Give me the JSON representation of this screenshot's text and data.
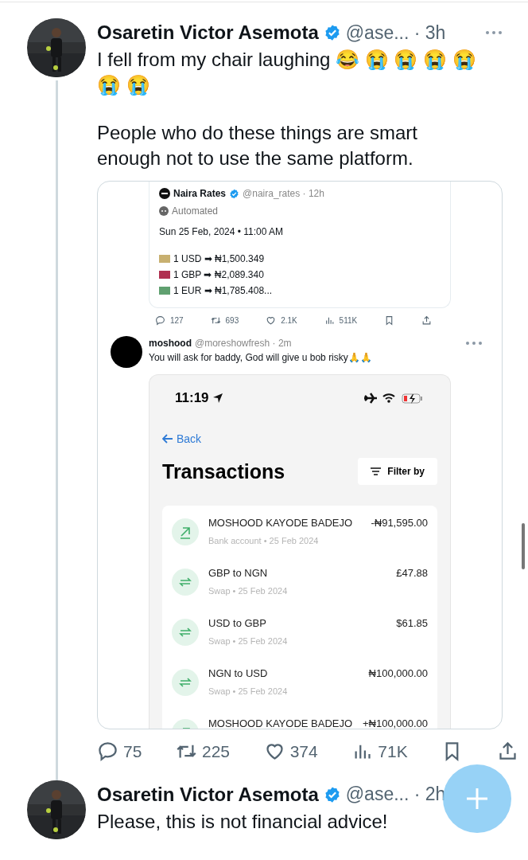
{
  "tweets": [
    {
      "author": "Osaretin Victor Asemota",
      "verified": true,
      "meta": "@ase... · 3h",
      "paragraphs": [
        "I fell from my chair laughing 😂 😭 😭 😭 😭 😭 😭",
        "People who do these things are smart enough not to use the same platform."
      ],
      "media": {
        "quoted": {
          "author": "Naira Rates",
          "verified": true,
          "meta": "@naira_rates · 12h",
          "label": "Automated",
          "date": "Sun 25 Feb, 2024 • 11:00 AM",
          "rates": [
            {
              "text": "1 USD ➡ ₦1,500.349",
              "color": "#c8b070"
            },
            {
              "text": "1 GBP ➡ ₦2,089.340",
              "color": "#b03050"
            },
            {
              "text": "1 EUR ➡ ₦1,785.408...",
              "color": "#60a070"
            }
          ]
        },
        "actions": [
          {
            "kind": "reply",
            "count": "127"
          },
          {
            "kind": "retweet",
            "count": "693"
          },
          {
            "kind": "like",
            "count": "2.1K"
          },
          {
            "kind": "views",
            "count": "511K"
          },
          {
            "kind": "bookmark"
          },
          {
            "kind": "share"
          }
        ],
        "reply": {
          "author": "moshood",
          "meta": "@moreshowfresh · 2m",
          "text": "You will ask for baddy, God will give u bob risky🙏🙏"
        },
        "phone": {
          "time": "11:19",
          "back": "Back",
          "title": "Transactions",
          "filter": "Filter by",
          "transactions": [
            {
              "kind": "transfer",
              "name": "MOSHOOD KAYODE BADEJO",
              "meta": "Bank account • 25 Feb 2024",
              "amount": "-₦91,595.00"
            },
            {
              "kind": "swap",
              "name": "GBP to NGN",
              "meta": "Swap • 25 Feb 2024",
              "amount": "£47.88"
            },
            {
              "kind": "swap",
              "name": "USD to GBP",
              "meta": "Swap • 25 Feb 2024",
              "amount": "$61.85"
            },
            {
              "kind": "swap",
              "name": "NGN to USD",
              "meta": "Swap • 25 Feb 2024",
              "amount": "₦100,000.00"
            },
            {
              "kind": "transfer",
              "name": "MOSHOOD KAYODE BADEJO",
              "amount": "+₦100,000.00"
            }
          ]
        }
      },
      "actions": [
        {
          "kind": "reply",
          "count": "75"
        },
        {
          "kind": "retweet",
          "count": "225"
        },
        {
          "kind": "like",
          "count": "374"
        },
        {
          "kind": "views",
          "count": "71K"
        },
        {
          "kind": "bookmark"
        },
        {
          "kind": "share"
        }
      ]
    },
    {
      "author": "Osaretin Victor Asemota",
      "verified": true,
      "meta": "@ase... · 2h",
      "paragraphs": [
        "Please, this is not financial advice!"
      ]
    }
  ]
}
